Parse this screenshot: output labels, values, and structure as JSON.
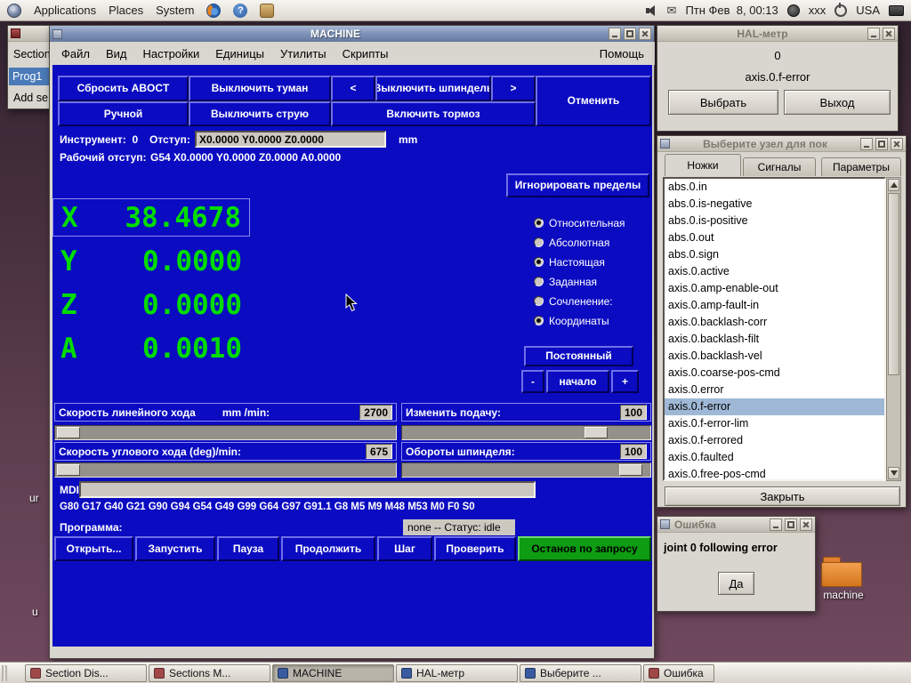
{
  "icons": {
    "help_glyph": "?",
    "mail_glyph": "✉"
  },
  "panel": {
    "menus": [
      {
        "label": "Applications"
      },
      {
        "label": "Places"
      },
      {
        "label": "System"
      }
    ],
    "clock": "Птн Фев  8, 00:13",
    "user_label": "xxx",
    "keyboard_layout": "USA"
  },
  "desktop": {
    "icon_label": "machine",
    "fragments": [
      "ur",
      "u"
    ]
  },
  "sections_window": {
    "section_label": "Section",
    "selected_program": "Prog1",
    "add_button": "Add se"
  },
  "machine": {
    "title": "MACHINE",
    "menus": [
      "Файл",
      "Вид",
      "Настройки",
      "Единицы",
      "Утилиты",
      "Скрипты"
    ],
    "help_menu": "Помощь",
    "toolbar": {
      "abort": "Сбросить ABOCT",
      "mist_off": "Выключить туман",
      "spindle_minus": "<",
      "spindle_off": "Выключить шпиндель",
      "spindle_plus": ">",
      "cancel": "Отменить",
      "manual": "Ручной",
      "flood_off": "Выключить струю",
      "brake_on": "Включить тормоз"
    },
    "tool_line": {
      "tool": "Инструмент:  0",
      "offset_label": "Отступ:",
      "offset_value": "X0.0000 Y0.0000 Z0.0000",
      "units": "mm"
    },
    "work_offset_label": "Рабочий отступ:",
    "work_offset_value": "G54 X0.0000 Y0.0000 Z0.0000 A0.0000",
    "ignore_limits": "Игнорировать пределы",
    "dro": {
      "color": "#00dc00",
      "axes": [
        {
          "letter": "X",
          "value": "38.4678"
        },
        {
          "letter": "Y",
          "value": "0.0000"
        },
        {
          "letter": "Z",
          "value": "0.0000"
        },
        {
          "letter": "A",
          "value": "0.0010"
        }
      ]
    },
    "radios": [
      {
        "label": "Относительная",
        "selected": true
      },
      {
        "label": "Абсолютная",
        "selected": false
      },
      {
        "label": "Настоящая",
        "selected": true
      },
      {
        "label": "Заданная",
        "selected": false
      },
      {
        "label": "Сочленение:",
        "selected": false
      },
      {
        "label": "Координаты",
        "selected": true
      }
    ],
    "jog": {
      "mode": "Постоянный",
      "minus": "-",
      "home": "начало",
      "plus": "+"
    },
    "feed": {
      "linear_label": "Скорость линейного хода",
      "linear_units": "mm /min:",
      "linear_value": "2700",
      "angular_label": "Скорость углового хода (deg)/min:",
      "angular_value": "675",
      "override_label": "Изменить подачу:",
      "override_value": "100",
      "spindle_label": "Обороты шпинделя:",
      "spindle_value": "100"
    },
    "mdi_label": "MDI:",
    "mdi_value": "",
    "active_gcodes": "G80 G17 G40 G21 G90 G94 G54 G49 G99 G64 G97 G91.1 G8 M5 M9 M48 M53 M0 F0 S0",
    "program_label": "Программа:",
    "program_status": "none -- Статус: idle",
    "run_buttons": [
      "Открыть...",
      "Запустить",
      "Пауза",
      "Продолжить",
      "Шаг",
      "Проверить"
    ],
    "estop_button": "Останов по запросу"
  },
  "halmeter": {
    "title": "HAL-метр",
    "value": "0",
    "signal": "axis.0.f-error",
    "select_button": "Выбрать",
    "exit_button": "Выход"
  },
  "picker": {
    "title": "Выберите узел для пок",
    "tabs": [
      "Ножки",
      "Сигналы",
      "Параметры"
    ],
    "active_tab": "Ножки",
    "items": [
      "abs.0.in",
      "abs.0.is-negative",
      "abs.0.is-positive",
      "abs.0.out",
      "abs.0.sign",
      "axis.0.active",
      "axis.0.amp-enable-out",
      "axis.0.amp-fault-in",
      "axis.0.backlash-corr",
      "axis.0.backlash-filt",
      "axis.0.backlash-vel",
      "axis.0.coarse-pos-cmd",
      "axis.0.error",
      "axis.0.f-error",
      "axis.0.f-error-lim",
      "axis.0.f-errored",
      "axis.0.faulted",
      "axis.0.free-pos-cmd"
    ],
    "selected_item": "axis.0.f-error",
    "close_button": "Закрыть"
  },
  "error_dialog": {
    "title": "Ошибка",
    "message": "joint 0 following error",
    "confirm_button": "Да"
  },
  "taskbar": [
    {
      "label": "Section Dis...",
      "icon_style": "background:#a04848"
    },
    {
      "label": "Sections M...",
      "icon_style": "background:#a04848"
    },
    {
      "label": "MACHINE",
      "icon_style": "background:#3a5aa0",
      "active": true
    },
    {
      "label": "HAL-метр",
      "icon_style": "background:#3a5aa0"
    },
    {
      "label": "Выберите ...",
      "icon_style": "background:#3a5aa0"
    },
    {
      "label": "Ошибка",
      "icon_style": "background:#a04848"
    }
  ]
}
